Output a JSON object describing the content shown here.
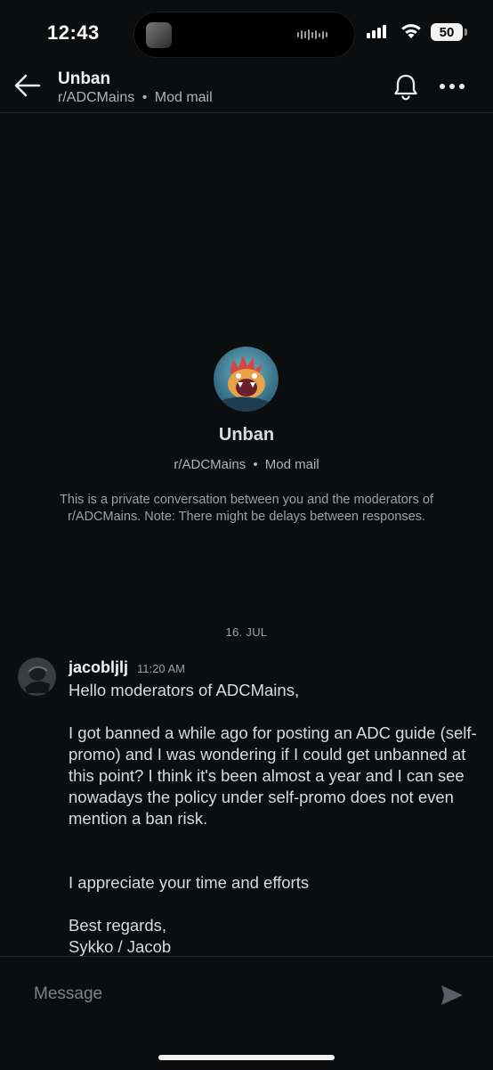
{
  "status_bar": {
    "time": "12:43",
    "battery": "50"
  },
  "header": {
    "title": "Unban",
    "subreddit": "r/ADCMains",
    "separator": "•",
    "context": "Mod mail",
    "back_icon": "arrow-left-icon",
    "bell_icon": "bell-icon",
    "more_icon": "more-horizontal-icon"
  },
  "intro": {
    "title": "Unban",
    "subreddit": "r/ADCMains",
    "separator": "•",
    "context": "Mod mail",
    "description": "This is a private conversation between you and the moderators of r/ADCMains. Note: There might be delays between responses."
  },
  "date_separator": "16. JUL",
  "message": {
    "author": "jacobljlj",
    "time": "11:20 AM",
    "paragraphs": [
      "Hello moderators of ADCMains,",
      "I got banned a while ago for posting an ADC guide (self-promo) and I was wondering if I could get unbanned at this point? I think it's been almost a year and I can see nowadays the policy under self-promo does not even mention a ban risk.",
      "I appreciate your time and efforts",
      "Best regards,\nSykko / Jacob"
    ]
  },
  "composer": {
    "placeholder": "Message",
    "value": "",
    "send_icon": "send-icon"
  },
  "colors": {
    "background": "#0b0d0f",
    "primary_text": "#f1f3f4",
    "secondary_text": "#aeb4b9"
  }
}
